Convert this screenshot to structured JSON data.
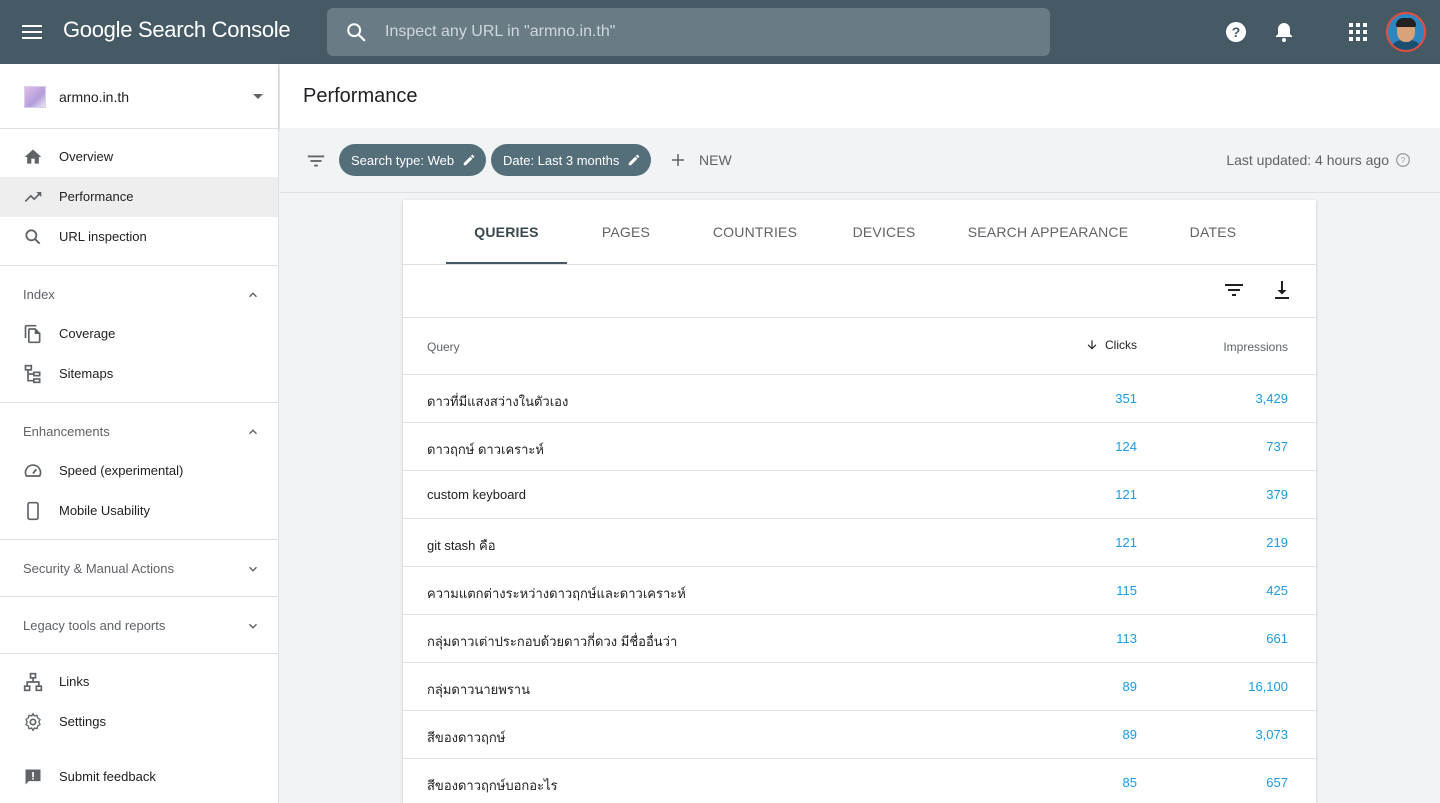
{
  "app": {
    "brand": "Google Search Console"
  },
  "topbar": {
    "search_placeholder": "Inspect any URL in \"armno.in.th\"",
    "icons": [
      "menu-icon",
      "search-icon",
      "help-icon",
      "notifications-icon",
      "apps-icon",
      "avatar"
    ]
  },
  "sidebar": {
    "property": "armno.in.th",
    "primary": [
      {
        "label": "Overview",
        "icon": "home-icon"
      },
      {
        "label": "Performance",
        "icon": "trending-up-icon",
        "active": true
      },
      {
        "label": "URL inspection",
        "icon": "search-icon"
      }
    ],
    "index": {
      "title": "Index",
      "items": [
        {
          "label": "Coverage",
          "icon": "file-copy-icon"
        },
        {
          "label": "Sitemaps",
          "icon": "sitemap-icon"
        }
      ]
    },
    "enhancements": {
      "title": "Enhancements",
      "items": [
        {
          "label": "Speed (experimental)",
          "icon": "speedometer-icon"
        },
        {
          "label": "Mobile Usability",
          "icon": "phone-icon"
        }
      ]
    },
    "security": {
      "title": "Security & Manual Actions"
    },
    "legacy": {
      "title": "Legacy tools and reports"
    },
    "bottom": [
      {
        "label": "Links",
        "icon": "links-icon"
      },
      {
        "label": "Settings",
        "icon": "gear-icon"
      }
    ],
    "feedback": {
      "label": "Submit feedback",
      "icon": "feedback-icon"
    }
  },
  "main": {
    "title": "Performance",
    "chips": [
      {
        "label": "Search type: Web"
      },
      {
        "label": "Date: Last 3 months"
      }
    ],
    "new_label": "NEW",
    "last_updated": "Last updated: 4 hours ago"
  },
  "report": {
    "tabs": [
      "QUERIES",
      "PAGES",
      "COUNTRIES",
      "DEVICES",
      "SEARCH APPEARANCE",
      "DATES"
    ],
    "active_tab": "QUERIES",
    "columns": {
      "query": "Query",
      "clicks": "Clicks",
      "impressions": "Impressions"
    },
    "rows": [
      {
        "query": "ดาวที่มีแสงสว่างในตัวเอง",
        "clicks": "351",
        "impressions": "3,429"
      },
      {
        "query": "ดาวฤกษ์ ดาวเคราะห์",
        "clicks": "124",
        "impressions": "737"
      },
      {
        "query": "custom keyboard",
        "clicks": "121",
        "impressions": "379"
      },
      {
        "query": "git stash คือ",
        "clicks": "121",
        "impressions": "219"
      },
      {
        "query": "ความแตกต่างระหว่างดาวฤกษ์และดาวเคราะห์",
        "clicks": "115",
        "impressions": "425"
      },
      {
        "query": "กลุ่มดาวเต่าประกอบด้วยดาวกี่ดวง มีชื่ออื่นว่า",
        "clicks": "113",
        "impressions": "661"
      },
      {
        "query": "กลุ่มดาวนายพราน",
        "clicks": "89",
        "impressions": "16,100"
      },
      {
        "query": "สีของดาวฤกษ์",
        "clicks": "89",
        "impressions": "3,073"
      },
      {
        "query": "สีของดาวฤกษ์บอกอะไร",
        "clicks": "85",
        "impressions": "657"
      }
    ]
  },
  "colors": {
    "topbar": "#455a64",
    "chip": "#546e7a",
    "link": "#1a9be8"
  }
}
